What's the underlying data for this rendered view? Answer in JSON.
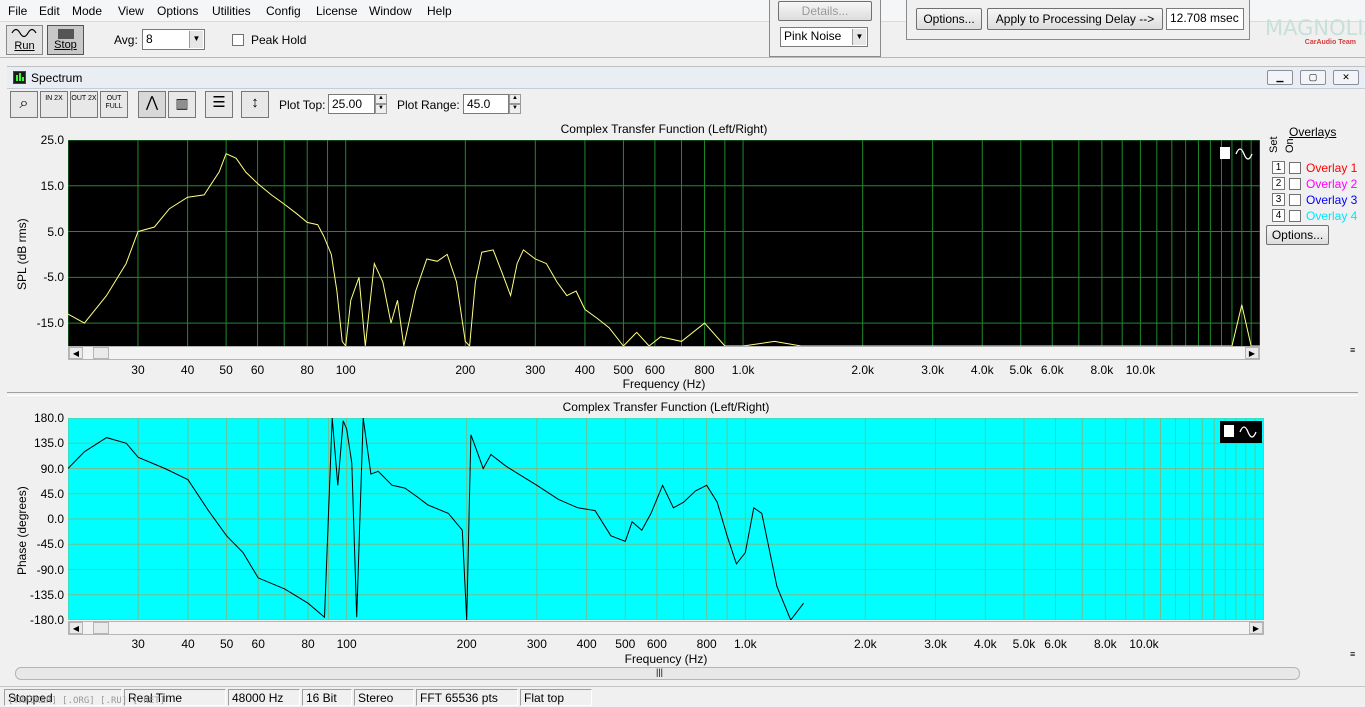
{
  "menu": [
    "File",
    "Edit",
    "Mode",
    "View",
    "Options",
    "Utilities",
    "Config",
    "License",
    "Window",
    "Help"
  ],
  "toolbar": {
    "run_label": "Run",
    "stop_label": "Stop",
    "avg_label": "Avg:",
    "avg_value": "8",
    "peak_hold_label": "Peak Hold",
    "details_label": "Details...",
    "signal_value": "Pink Noise",
    "options_label": "Options...",
    "apply_delay_label": "Apply to Processing Delay -->",
    "delay_value": "12.708 msec"
  },
  "logo": {
    "name": "MAGNOLIA",
    "sub": "CarAudio Team"
  },
  "window": {
    "title": "Spectrum"
  },
  "plot_controls": {
    "plot_top_label": "Plot Top:",
    "plot_top_value": "25.00",
    "plot_range_label": "Plot Range:",
    "plot_range_value": "45.0",
    "zoom_buttons": [
      "IN 2X",
      "OUT 2X",
      "OUT FULL"
    ]
  },
  "overlays": {
    "title": "Overlays",
    "set_label": "Set",
    "on_label": "On",
    "items": [
      {
        "num": "1",
        "label": "Overlay 1",
        "color": "#ff0000"
      },
      {
        "num": "2",
        "label": "Overlay 2",
        "color": "#ff00ff"
      },
      {
        "num": "3",
        "label": "Overlay 3",
        "color": "#0000ff"
      },
      {
        "num": "4",
        "label": "Overlay 4",
        "color": "#00e5ff"
      }
    ],
    "options_label": "Options..."
  },
  "chart_data": [
    {
      "type": "line",
      "title": "Complex Transfer Function (Left/Right)",
      "xlabel": "Frequency (Hz)",
      "ylabel": "SPL (dB rms)",
      "xscale": "log",
      "xlim": [
        20,
        20000
      ],
      "ylim": [
        -20,
        25
      ],
      "yticks": [
        "25.0",
        "15.0",
        "5.0",
        "-5.0",
        "-15.0"
      ],
      "xticks": [
        "30",
        "40",
        "50",
        "60",
        "80",
        "100",
        "200",
        "300",
        "400",
        "500",
        "600",
        "800",
        "1.0k",
        "2.0k",
        "3.0k",
        "4.0k",
        "5.0k",
        "6.0k",
        "8.0k",
        "10.0k"
      ],
      "background": "#000000",
      "grid_color": "#1f8a2a",
      "series": [
        {
          "color": "#ffff80",
          "x": [
            20,
            22,
            25,
            28,
            30,
            33,
            36,
            40,
            44,
            48,
            50,
            53,
            56,
            60,
            65,
            70,
            75,
            80,
            85,
            88,
            92,
            95,
            98,
            100,
            103,
            108,
            112,
            118,
            124,
            130,
            135,
            140,
            150,
            160,
            170,
            180,
            190,
            200,
            205,
            212,
            220,
            235,
            250,
            260,
            270,
            280,
            300,
            320,
            340,
            360,
            380,
            400,
            430,
            460,
            500,
            540,
            580,
            620,
            700,
            800,
            900,
            1000,
            1200,
            1400,
            1500,
            2000,
            5000,
            10000,
            17000,
            18000,
            19000,
            20000
          ],
          "y": [
            -13,
            -15,
            -9,
            -2,
            5,
            6,
            10,
            12.5,
            13,
            18,
            22,
            21,
            18,
            15.5,
            13,
            11,
            9,
            7,
            6.5,
            4,
            0,
            -8,
            -19,
            -20,
            -10,
            -5,
            -20,
            -2,
            -6,
            -15,
            -10,
            -20,
            -8,
            -1,
            -1.5,
            0,
            -6,
            -19,
            -20,
            -6,
            0.5,
            1,
            -5,
            -9,
            -2,
            1,
            -1,
            -2,
            -6,
            -9,
            -8,
            -12,
            -14,
            -16,
            -20,
            -17,
            -20,
            -18,
            -19,
            -15,
            -20,
            -20,
            -19,
            -20,
            -20,
            -20,
            -20,
            -20,
            -20,
            -11,
            -20,
            -20
          ]
        }
      ]
    },
    {
      "type": "line",
      "title": "Complex Transfer Function (Left/Right)",
      "xlabel": "Frequency (Hz)",
      "ylabel": "Phase (degrees)",
      "xscale": "log",
      "xlim": [
        20,
        20000
      ],
      "ylim": [
        -180,
        180
      ],
      "yticks": [
        "180.0",
        "135.0",
        "90.0",
        "45.0",
        "0.0",
        "-45.0",
        "-90.0",
        "-135.0",
        "-180.0"
      ],
      "xticks": [
        "30",
        "40",
        "50",
        "60",
        "80",
        "100",
        "200",
        "300",
        "400",
        "500",
        "600",
        "800",
        "1.0k",
        "2.0k",
        "3.0k",
        "4.0k",
        "5.0k",
        "6.0k",
        "8.0k",
        "10.0k"
      ],
      "background": "#00ffff",
      "grid_color": "#6fbf8f",
      "series": [
        {
          "color": "#000000",
          "x": [
            20,
            22,
            25,
            28,
            30,
            35,
            40,
            45,
            50,
            55,
            60,
            70,
            80,
            88,
            92,
            95,
            98,
            100,
            103,
            106,
            110,
            115,
            120,
            130,
            140,
            150,
            160,
            180,
            195,
            200,
            205,
            210,
            220,
            230,
            250,
            270,
            300,
            340,
            380,
            420,
            460,
            500,
            520,
            550,
            580,
            620,
            660,
            700,
            750,
            800,
            850,
            900,
            950,
            1000,
            1050,
            1100,
            1200,
            1300,
            1400
          ],
          "y": [
            90,
            120,
            145,
            135,
            110,
            90,
            70,
            15,
            -30,
            -60,
            -105,
            -125,
            -150,
            -175,
            180,
            60,
            175,
            160,
            100,
            -175,
            180,
            80,
            85,
            60,
            55,
            40,
            25,
            10,
            -20,
            -180,
            150,
            130,
            90,
            115,
            95,
            80,
            60,
            35,
            20,
            15,
            -30,
            -40,
            -5,
            -20,
            10,
            60,
            20,
            30,
            50,
            60,
            30,
            -30,
            -80,
            -60,
            20,
            10,
            -120,
            -180,
            -150
          ]
        }
      ]
    }
  ],
  "statusbar": [
    "Stopped",
    "Real Time",
    "48000 Hz",
    "16 Bit",
    "Stereo",
    "FFT 65536 pts",
    "Flat top"
  ],
  "watermark": "[TRACKER] [.ORG] [.RU] [.NET]"
}
